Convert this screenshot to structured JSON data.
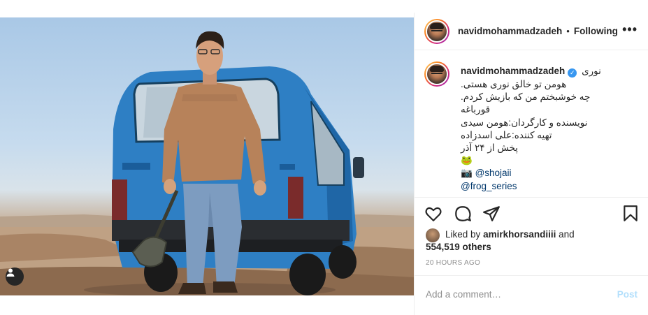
{
  "post": {
    "author": "navidmohammadzadeh",
    "follow_dot": "•",
    "follow_label": "Following",
    "more_label": "•••"
  },
  "caption": {
    "username": "navidmohammadzadeh",
    "verified_mark": "✓",
    "first_line_text": "نوری",
    "lines": [
      "هومن تو خالق نوری هستی.",
      "چه خوشبختم من که بازیش کردم.",
      "قورباغه",
      "نویسنده و کارگردان:هومن سیدی",
      "تهیه کننده:علی اسدزاده",
      "پخش از ۲۴ آذر",
      "🐸"
    ],
    "camera_emoji": "📷",
    "mention_1": "@shojaii",
    "mention_2": "@frog_series"
  },
  "likes": {
    "prefix": "Liked by",
    "user": "amirkhorsandiiii",
    "connector": "and",
    "count": "554,519 others"
  },
  "timestamp": "20 HOURS AGO",
  "comment": {
    "placeholder": "Add a comment…",
    "post_label": "Post"
  },
  "icons": {
    "like": "heart-icon",
    "comment": "comment-bubble-icon",
    "share": "paper-plane-icon",
    "save": "bookmark-icon",
    "tag": "user-tag-icon"
  },
  "colors": {
    "link": "#00376b",
    "verified": "#3897f0",
    "post_disabled": "#b2dffc",
    "meta": "#8e8e8e"
  }
}
